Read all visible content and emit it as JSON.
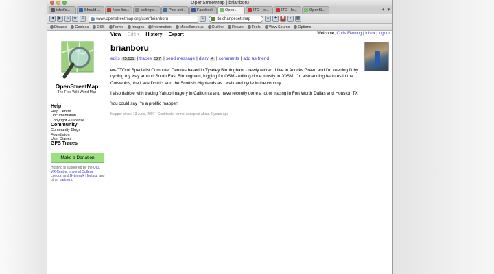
{
  "window": {
    "title": "OpenStreetMap | brianboru"
  },
  "tabs": [
    {
      "label": "ichef's...",
      "color": "#5a5a5a"
    },
    {
      "label": "Should ...",
      "color": "#2c6ab0"
    },
    {
      "label": "New libr...",
      "color": "#c0392b"
    },
    {
      "label": "collingto...",
      "color": "#888888"
    },
    {
      "label": "Post set...",
      "color": "#3b6ea5"
    },
    {
      "label": "Facebook",
      "color": "#3b5998"
    },
    {
      "label": "Open...",
      "color": "#7ebc6f",
      "active": true
    },
    {
      "label": "ITO - le...",
      "color": "#cc3333"
    },
    {
      "label": "ITO - le...",
      "color": "#cc3333"
    },
    {
      "label": "OpenSt...",
      "color": "#7ebc6f"
    }
  ],
  "url": "www.openstreetmap.org/user/brianboru",
  "search": {
    "value": "ito changeset map"
  },
  "dev_toolbar": [
    "Disable",
    "Cookies",
    "CSS",
    "Forms",
    "Images",
    "Information",
    "Miscellaneous",
    "Outline",
    "Resize",
    "Tools",
    "View Source",
    "Options"
  ],
  "sidebar": {
    "logo_name": "OpenStreetMap",
    "logo_tag": "The Free Wiki World Map",
    "nav": [
      {
        "label": "Help",
        "heading": true
      },
      {
        "label": "Help Centre"
      },
      {
        "label": "Documentation"
      },
      {
        "label": "Copyright & License"
      },
      {
        "label": "Community",
        "heading": true
      },
      {
        "label": "Community Blogs"
      },
      {
        "label": "Foundation"
      },
      {
        "label": "User Diaries"
      },
      {
        "label": "GPS Traces",
        "heading": true
      }
    ],
    "donate_label": "Make a Donation",
    "hosting_text": "Hosting is supported by the",
    "hosting_links": [
      "UCL VR Centre",
      "Imperial College London",
      "Bytemark Hosting"
    ],
    "hosting_tail": "and other",
    "partners": "partners."
  },
  "topnav": {
    "view": "View",
    "edit": "Edit",
    "history": "History",
    "export": "Export"
  },
  "userbox": {
    "welcome": "Welcome,",
    "user": "Chris Fleming",
    "inbox": "inbox",
    "logout": "logout"
  },
  "profile": {
    "username": "brianboru",
    "edits_label": "edits",
    "edits_count": "25,131",
    "traces_label": "traces",
    "traces_count": "527",
    "send_message": "send message",
    "diary_label": "diary",
    "diary_count": "4",
    "comments": "comments",
    "add_friend": "add as friend",
    "bio": [
      "ex-CTO of Specialist Computer Centres based in Tyseley Birmingham - newly retired. I live in Acocks Green and I'm keeping fit by cycling my way around South East Birmingham, logging for OSM - editing done mostly in JOSM. I'm also adding features in the Cotswolds, the Lake District and the Scottish Highlands as I walk and cycle in the country",
      "I also dabble with tracing Yahoo imagery in California and have recently done a lot of tracing in Fort Worth Dallas and Houston TX",
      "You could say I'm a prolific mapper!"
    ],
    "meta": "Mapper since: 13 June, 2007 / Contributor terms: Accepted about 2 years ago"
  }
}
